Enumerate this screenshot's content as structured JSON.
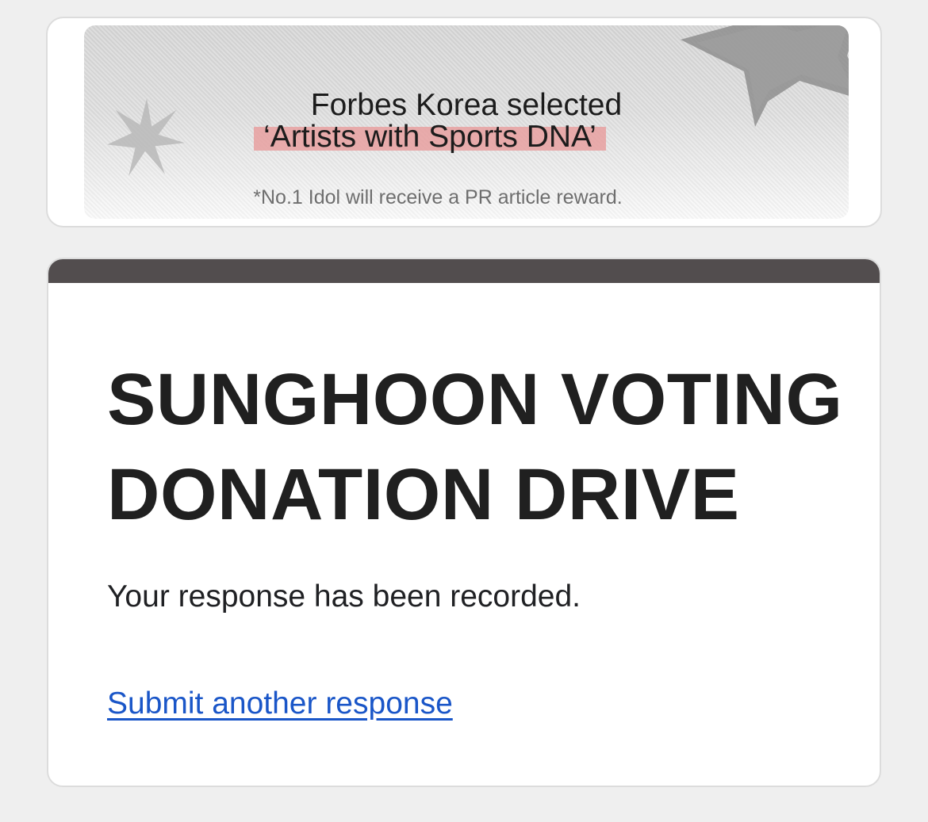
{
  "banner": {
    "line1": "Forbes Korea selected",
    "line2": "‘Artists with Sports DNA’",
    "note": "*No.1 Idol will receive a PR article reward.",
    "highlight_color": "#e8a0a0"
  },
  "form": {
    "accent_color": "#524d4e",
    "title": "SUNGHOON VOTING DONATION DRIVE",
    "confirmation": "Your response has been recorded.",
    "submit_another_link": "Submit another response",
    "link_color": "#1a56c8"
  },
  "icons": [
    "star-left-icon",
    "star-right-icon"
  ]
}
